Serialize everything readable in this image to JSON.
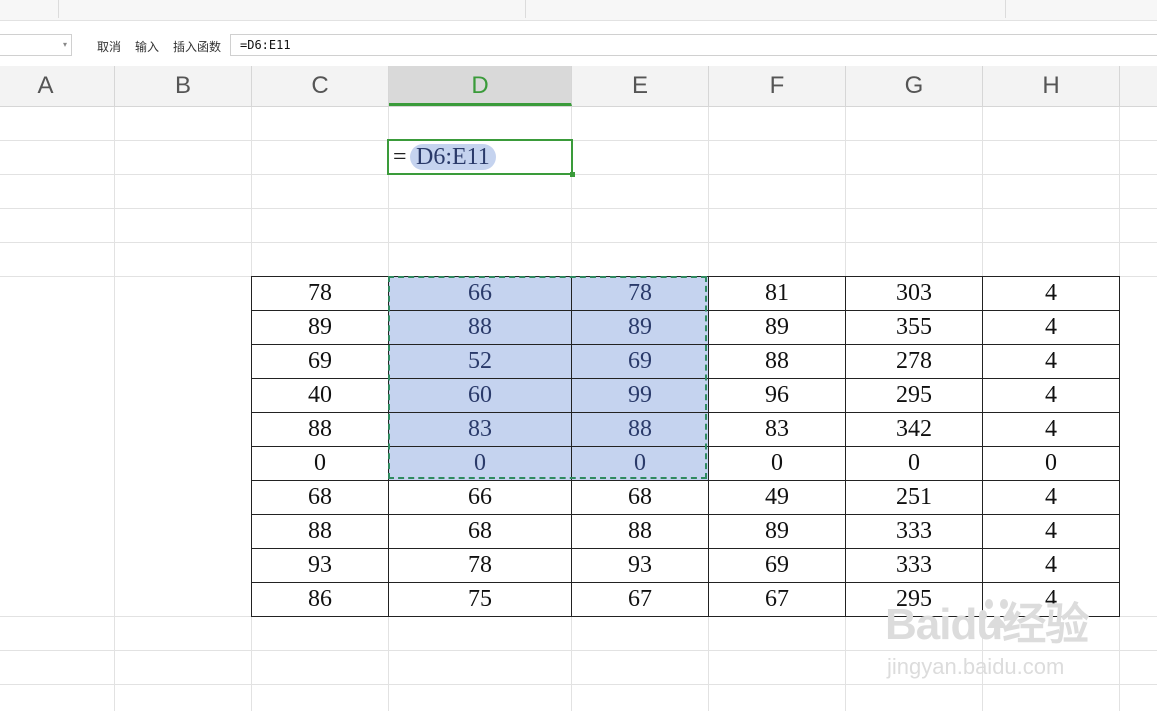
{
  "formula_bar": {
    "cancel_label": "取消",
    "enter_label": "输入",
    "insert_function_label": "插入函数",
    "formula": "=D6:E11"
  },
  "columns": [
    "A",
    "B",
    "C",
    "D",
    "E",
    "F",
    "G",
    "H"
  ],
  "active_column": "D",
  "edit_cell": {
    "equals": "=",
    "reference": "D6:E11"
  },
  "table": {
    "rows": [
      [
        "78",
        "66",
        "78",
        "81",
        "303",
        "4"
      ],
      [
        "89",
        "88",
        "89",
        "89",
        "355",
        "4"
      ],
      [
        "69",
        "52",
        "69",
        "88",
        "278",
        "4"
      ],
      [
        "40",
        "60",
        "99",
        "96",
        "295",
        "4"
      ],
      [
        "88",
        "83",
        "88",
        "83",
        "342",
        "4"
      ],
      [
        "0",
        "0",
        "0",
        "0",
        "0",
        "0"
      ],
      [
        "68",
        "66",
        "68",
        "49",
        "251",
        "4"
      ],
      [
        "88",
        "68",
        "88",
        "89",
        "333",
        "4"
      ],
      [
        "93",
        "78",
        "93",
        "69",
        "333",
        "4"
      ],
      [
        "86",
        "75",
        "67",
        "67",
        "295",
        "4"
      ]
    ]
  },
  "colors": {
    "accent_green": "#3a9b3a",
    "selection_fill": "#c5d3ef",
    "selection_border": "#2f8a5f"
  },
  "watermark": {
    "logo": "Baidu经验",
    "url": "jingyan.baidu.com"
  },
  "icons": {
    "name_box_dropdown": "chevron-down-icon",
    "watermark_paw": "paw-icon"
  }
}
